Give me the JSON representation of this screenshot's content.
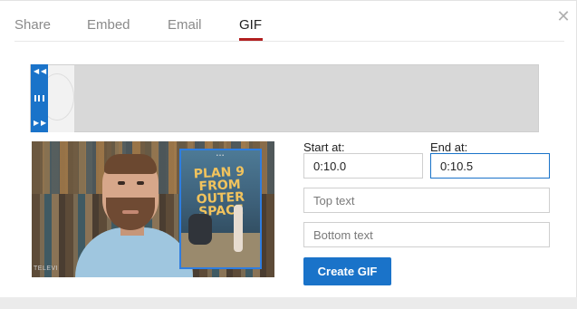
{
  "tabs": [
    {
      "label": "Share"
    },
    {
      "label": "Embed"
    },
    {
      "label": "Email"
    },
    {
      "label": "GIF",
      "active": true
    }
  ],
  "close_icon": "close-icon",
  "preview": {
    "poster_title": "PLAN 9 FROM OUTER SPACE",
    "corner_text": "TELEVI"
  },
  "form": {
    "start_label": "Start at:",
    "start_value": "0:10.0",
    "end_label": "End at:",
    "end_value": "0:10.5",
    "top_text_placeholder": "Top text",
    "bottom_text_placeholder": "Bottom text",
    "create_button": "Create GIF"
  },
  "colors": {
    "accent": "#1a73c9",
    "active_tab_underline": "#b21f20",
    "selection_border": "#2e7de1"
  }
}
